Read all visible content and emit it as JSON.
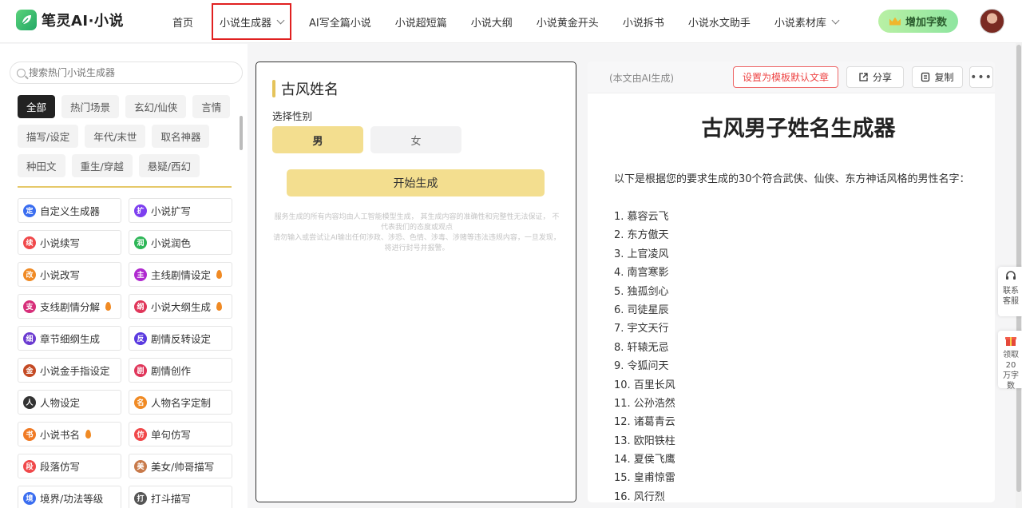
{
  "header": {
    "logo_text": "笔灵AI·小说",
    "nav": [
      {
        "label": "首页"
      },
      {
        "label": "小说生成器"
      },
      {
        "label": "AI写全篇小说"
      },
      {
        "label": "小说超短篇"
      },
      {
        "label": "小说大纲"
      },
      {
        "label": "小说黄金开头"
      },
      {
        "label": "小说拆书"
      },
      {
        "label": "小说水文助手"
      },
      {
        "label": "小说素材库"
      }
    ],
    "add_words_label": "增加字数"
  },
  "sidebar": {
    "search_placeholder": "搜索热门小说生成器",
    "tags": [
      "全部",
      "热门场景",
      "玄幻/仙侠",
      "言情",
      "描写/设定",
      "年代/末世",
      "取名神器",
      "种田文",
      "重生/穿越",
      "悬疑/西幻"
    ],
    "tools": [
      {
        "label": "自定义生成器",
        "icon": "定",
        "color": "#3a6df0"
      },
      {
        "label": "小说扩写",
        "icon": "扩",
        "color": "#7d3ff0"
      },
      {
        "label": "小说续写",
        "icon": "续",
        "color": "#f0484a"
      },
      {
        "label": "小说润色",
        "icon": "润",
        "color": "#2db657"
      },
      {
        "label": "小说改写",
        "icon": "改",
        "color": "#f08a24"
      },
      {
        "label": "主线剧情设定",
        "icon": "主",
        "color": "#b02ad0"
      },
      {
        "label": "支线剧情分解",
        "icon": "支",
        "color": "#d72f7a"
      },
      {
        "label": "小说大纲生成",
        "icon": "纲",
        "color": "#e0365a"
      },
      {
        "label": "章节细纲生成",
        "icon": "细",
        "color": "#6a3ad0"
      },
      {
        "label": "剧情反转设定",
        "icon": "反",
        "color": "#5a3ae0"
      },
      {
        "label": "小说金手指设定",
        "icon": "金",
        "color": "#c44a24"
      },
      {
        "label": "剧情创作",
        "icon": "剧",
        "color": "#e0365a"
      },
      {
        "label": "人物设定",
        "icon": "人",
        "color": "#333333"
      },
      {
        "label": "人物名字定制",
        "icon": "名",
        "color": "#f08a24"
      },
      {
        "label": "小说书名",
        "icon": "书",
        "color": "#f07a24"
      },
      {
        "label": "单句仿写",
        "icon": "仿",
        "color": "#f0484a"
      },
      {
        "label": "段落仿写",
        "icon": "段",
        "color": "#f0484a"
      },
      {
        "label": "美女/帅哥描写",
        "icon": "美",
        "color": "#c87a4a"
      },
      {
        "label": "境界/功法等级",
        "icon": "境",
        "color": "#3a6df0"
      },
      {
        "label": "打斗描写",
        "icon": "打",
        "color": "#555555"
      }
    ],
    "flame_labels": [
      "主线剧情设定",
      "支线剧情分解",
      "小说大纲生成",
      "小说书名"
    ]
  },
  "form": {
    "title": "古风姓名",
    "gender_label": "选择性别",
    "male": "男",
    "female": "女",
    "generate": "开始生成",
    "disclaimer": "服务生成的所有内容均由人工智能模型生成， 其生成内容的准确性和完整性无法保证， 不代表我们的态度或观点\n请勿输入或尝试让AI输出任何涉政、涉恐、色情、涉毒、涉赌等违法违规内容，一旦发现，将进行封号并报警。"
  },
  "result": {
    "ai_note": "(本文由AI生成)",
    "set_default": "设置为模板默认文章",
    "share": "分享",
    "copy": "复制",
    "title": "古风男子姓名生成器",
    "intro": "以下是根据您的要求生成的30个符合武侠、仙侠、东方神话风格的男性名字：",
    "names": [
      "1. 慕容云飞",
      "2. 东方傲天",
      "3. 上官凌风",
      "4. 南宫寒影",
      "5. 独孤剑心",
      "6. 司徒星辰",
      "7. 宇文天行",
      "8. 轩辕无忌",
      "9. 令狐问天",
      "10. 百里长风",
      "11. 公孙浩然",
      "12. 诸葛青云",
      "13. 欧阳铁柱",
      "14. 夏侯飞鹰",
      "15. 皇甫惊雷",
      "16. 风行烈"
    ]
  },
  "floats": {
    "contact": "联系客服",
    "gift": "领取20万字数"
  }
}
